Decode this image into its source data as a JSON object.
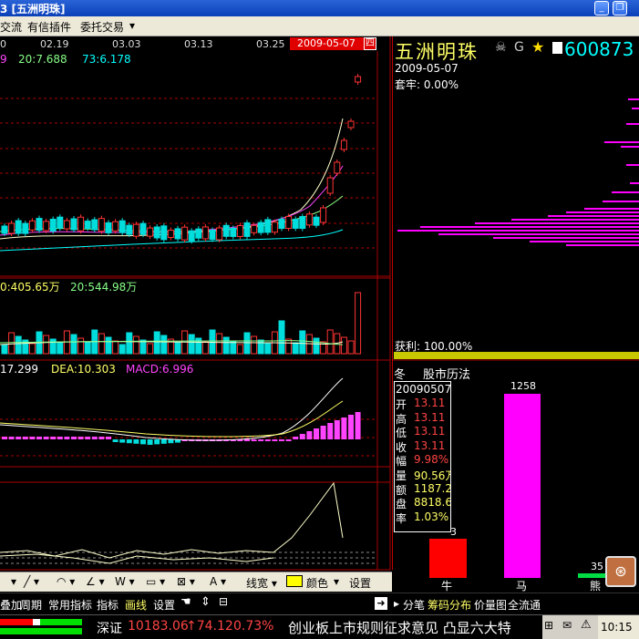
{
  "window": {
    "title": "3 [五洲明珠]",
    "buttons": [
      "_",
      "❐"
    ]
  },
  "menubar": {
    "items": [
      "交流",
      "有信插件",
      "委托交易",
      "▾"
    ]
  },
  "price_chart": {
    "date_ticks": [
      "02.19",
      "03.03",
      "03.13",
      "03.25"
    ],
    "left_partial_tick": "0",
    "current_date_flag": "2009-05-07",
    "current_day": "四",
    "ma_labels": [
      {
        "text": "9",
        "color": "#ff44ff"
      },
      {
        "text": "20:7.688",
        "color": "#88ff88"
      },
      {
        "text": "73:6.178",
        "color": "#00ffff"
      }
    ]
  },
  "volume_chart": {
    "labels": [
      {
        "text": "0:405.65万",
        "color": "#ffff66"
      },
      {
        "text": "20:544.98万",
        "color": "#88ff88"
      }
    ]
  },
  "macd_chart": {
    "labels": [
      {
        "text": "17.299",
        "color": "#ffffff"
      },
      {
        "text": "DEA:10.303",
        "color": "#ffff66"
      },
      {
        "text": "MACD:6.996",
        "color": "#ff44ff"
      }
    ]
  },
  "right_panel": {
    "stock_name": "五洲明珠",
    "stock_code": "600873",
    "chip_date": "2009-05-07",
    "trapped": "套牢: 0.00%",
    "profit": "获利: 100.00%",
    "season": "冬",
    "calendar_title": "股市历法"
  },
  "info_box": {
    "date": "20090507",
    "rows": [
      {
        "label": "开",
        "value": "13.11",
        "color": "#ff4444"
      },
      {
        "label": "高",
        "value": "13.11",
        "color": "#ff4444"
      },
      {
        "label": "低",
        "value": "13.11",
        "color": "#ff4444"
      },
      {
        "label": "收",
        "value": "13.11",
        "color": "#ff4444"
      },
      {
        "label": "幅",
        "value": "9.98%",
        "color": "#ff4444"
      },
      {
        "label": "量",
        "value": "90.56万",
        "color": "#ffff66"
      },
      {
        "label": "额",
        "value": "1187.2",
        "color": "#ffff66"
      },
      {
        "label": "盘",
        "value": "8818.6",
        "color": "#ffff66"
      },
      {
        "label": "率",
        "value": "1.03%",
        "color": "#ffff66"
      }
    ]
  },
  "calendar_bars": {
    "bull_label": "牛",
    "horse_label": "马",
    "bear_label": "熊",
    "bull_value": "3",
    "horse_value": "1258",
    "bear_value": "35"
  },
  "draw_toolbar": {
    "items": [
      "▾",
      "╱ ▾",
      "◠ ▾",
      "∠ ▾",
      "W ▾",
      "▭ ▾",
      "⊠ ▾",
      "A ▾"
    ],
    "line_width": "线宽 ▾",
    "color_label": "颜色",
    "color_dropdown": "▾",
    "settings": "设置"
  },
  "func_bar": {
    "left_items": [
      "叠加",
      "周期",
      "常用指标",
      "指标",
      "画线",
      "设置"
    ],
    "right_items": [
      "分笔",
      "筹码分布",
      "价量图",
      "全流通"
    ]
  },
  "status_bar": {
    "index_name": "深证",
    "index_value": "10183.06",
    "index_change": "↑74.12",
    "index_pct": "0.73%",
    "news": "创业板上市规则征求意见  凸显六大特",
    "clock": "10:15"
  },
  "colors": {
    "up": "#ff3333",
    "down": "#00dddd",
    "ma5": "#ffffcc",
    "ma10": "#ff44ff",
    "ma20": "#88ff88",
    "ma60": "#00ffff",
    "grid": "#aa0000"
  }
}
